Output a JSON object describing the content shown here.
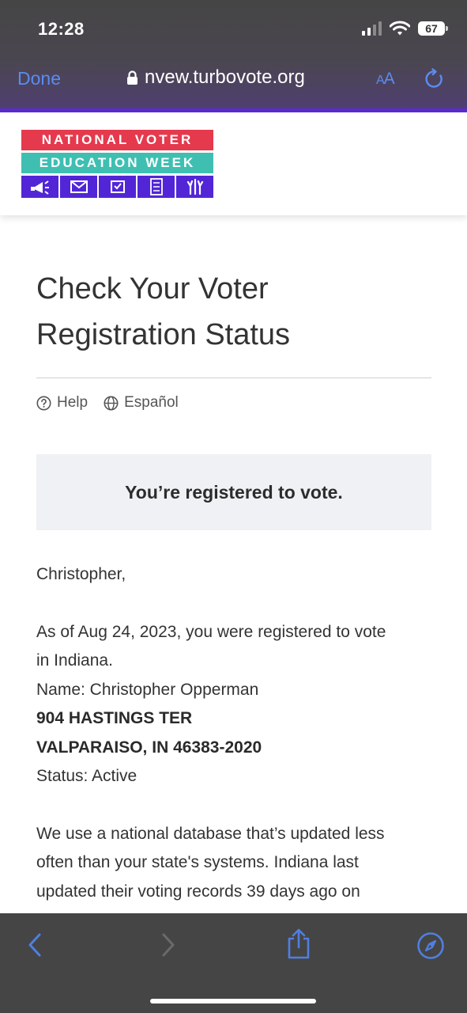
{
  "status_bar": {
    "time": "12:28",
    "battery": "67"
  },
  "browser": {
    "done_label": "Done",
    "url": "nvew.turbovote.org",
    "text_size_label_small": "A",
    "text_size_label_large": "A"
  },
  "logo": {
    "line1": "NATIONAL VOTER",
    "line2": "EDUCATION WEEK",
    "icons": [
      "megaphone-icon",
      "mail-icon",
      "ballot-box-icon",
      "checklist-icon",
      "raised-hands-icon"
    ]
  },
  "page": {
    "title_line1": "Check Your Voter",
    "title_line2": "Registration Status",
    "help_label": "Help",
    "language_label": "Español",
    "status_message": "You’re registered to vote.",
    "greeting": "Christopher,",
    "para1_line1": "As of Aug 24, 2023, you were registered to vote",
    "para1_line2": "in Indiana.",
    "name_line": "Name: Christopher Opperman",
    "address_line1": "904 HASTINGS TER",
    "address_line2": "VALPARAISO, IN 46383-2020",
    "status_line": "Status: Active",
    "para2_line1": "We use a national database that’s updated less",
    "para2_line2": "often than your state's systems. Indiana last",
    "para2_line3": "updated their voting records 39 days ago on"
  },
  "colors": {
    "logo_red": "#e5394d",
    "logo_teal": "#3fbfb2",
    "logo_purple": "#5226d6",
    "safari_blue": "#5a8cf0",
    "status_box_bg": "#f0f1f5"
  }
}
